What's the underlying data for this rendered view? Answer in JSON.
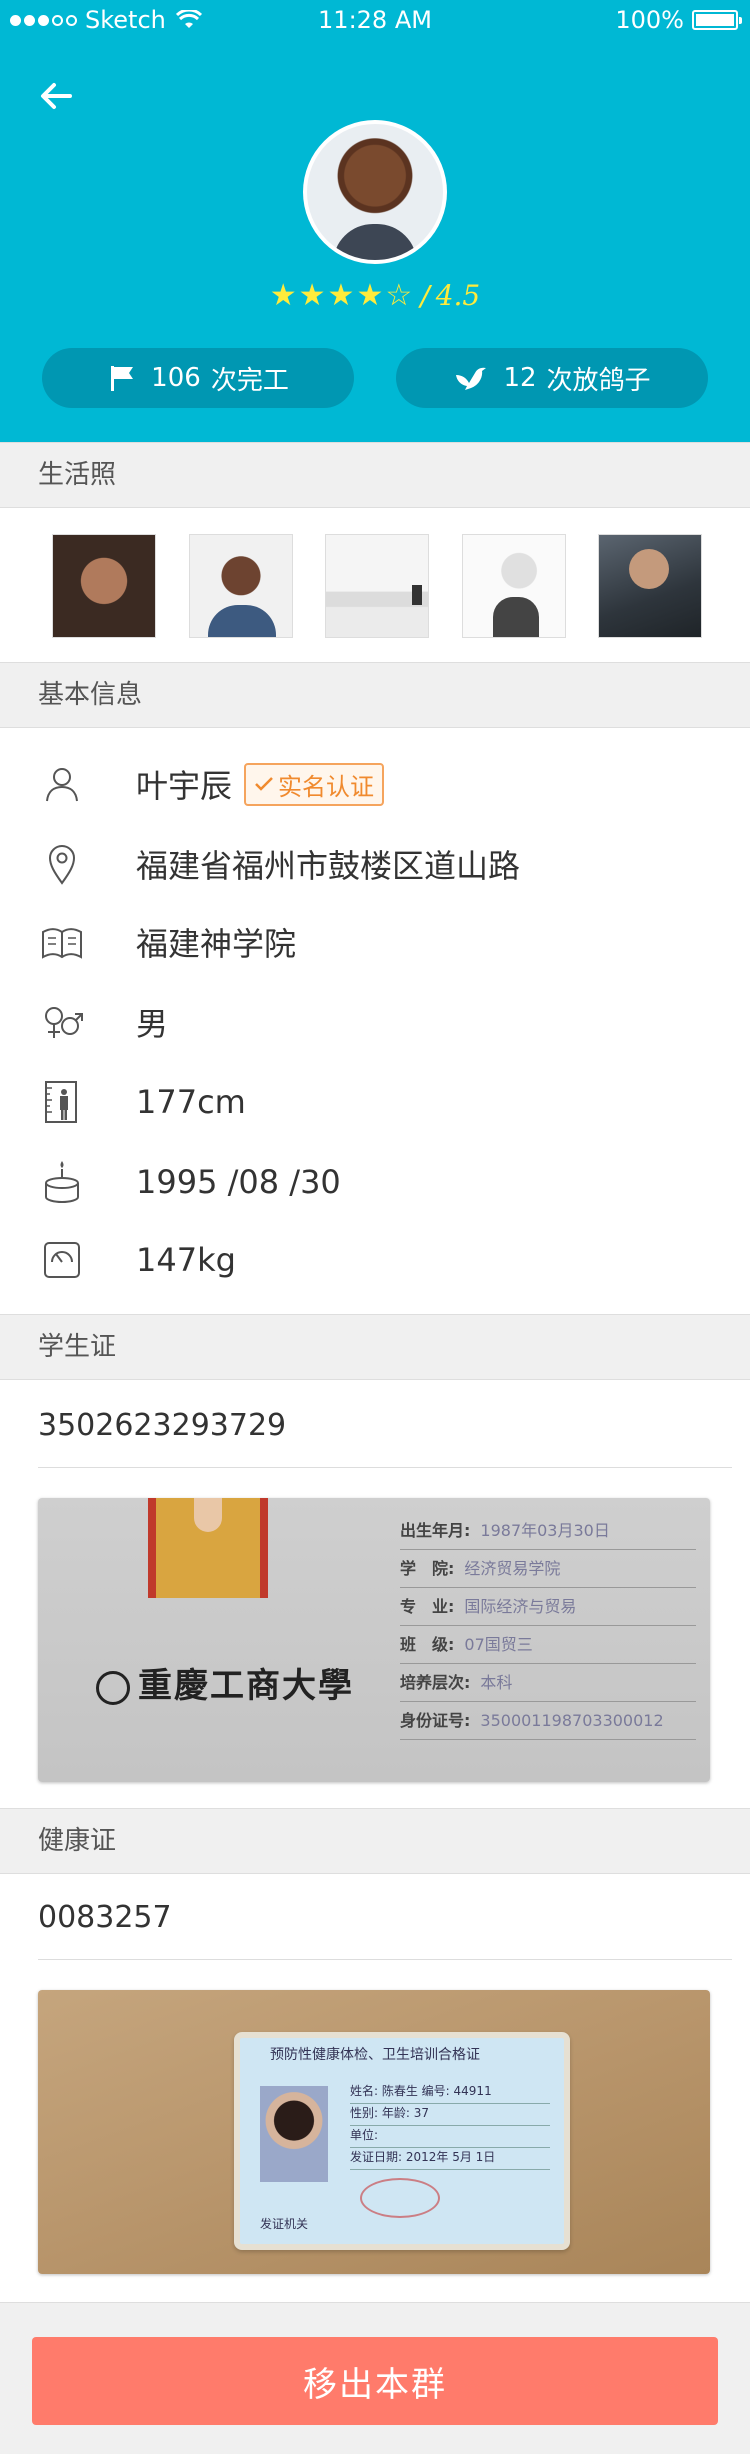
{
  "status_bar": {
    "carrier": "Sketch",
    "time": "11:28 AM",
    "battery": "100%"
  },
  "profile": {
    "rating_value": "4.5",
    "rating_separator": "/",
    "stars": "★★★★☆",
    "stats": [
      {
        "value": "106",
        "label": "次完工",
        "icon": "flag-icon"
      },
      {
        "value": "12",
        "label": "次放鸽子",
        "icon": "pigeon-icon"
      }
    ]
  },
  "sections": {
    "photos_title": "生活照",
    "basic_info_title": "基本信息",
    "student_id_title": "学生证",
    "health_cert_title": "健康证"
  },
  "basic_info": {
    "name": "叶宇辰",
    "verified_label": "实名认证",
    "address": "福建省福州市鼓楼区道山路",
    "school": "福建神学院",
    "gender": "男",
    "height": "177cm",
    "birthday": "1995 /08 /30",
    "weight": "147kg"
  },
  "student_id": {
    "number": "3502623293729",
    "card_school": "重慶工商大學",
    "fields": [
      {
        "label": "出生年月:",
        "value": "1987年03月30日"
      },
      {
        "label": "学　院:",
        "value": "经济贸易学院"
      },
      {
        "label": "专　业:",
        "value": "国际经济与贸易"
      },
      {
        "label": "班　级:",
        "value": "07国贸三"
      },
      {
        "label": "培养层次:",
        "value": "本科"
      },
      {
        "label": "身份证号:",
        "value": "350001198703300012"
      }
    ]
  },
  "health_cert": {
    "number": "0083257",
    "card_title": "预防性健康体检、卫生培训合格证",
    "lines": [
      "姓名: 陈春生  编号: 44911",
      "性别:     年龄: 37",
      "单位:",
      "发证日期: 2012年 5月 1日"
    ],
    "issuer": "发证机关"
  },
  "footer": {
    "remove_label": "移出本群"
  },
  "colors": {
    "header_bg": "#00B8D4",
    "pill_bg": "#0097B2",
    "star": "#FFEB3B",
    "badge": "#F08A2E",
    "danger_button": "#FF7B6B"
  }
}
